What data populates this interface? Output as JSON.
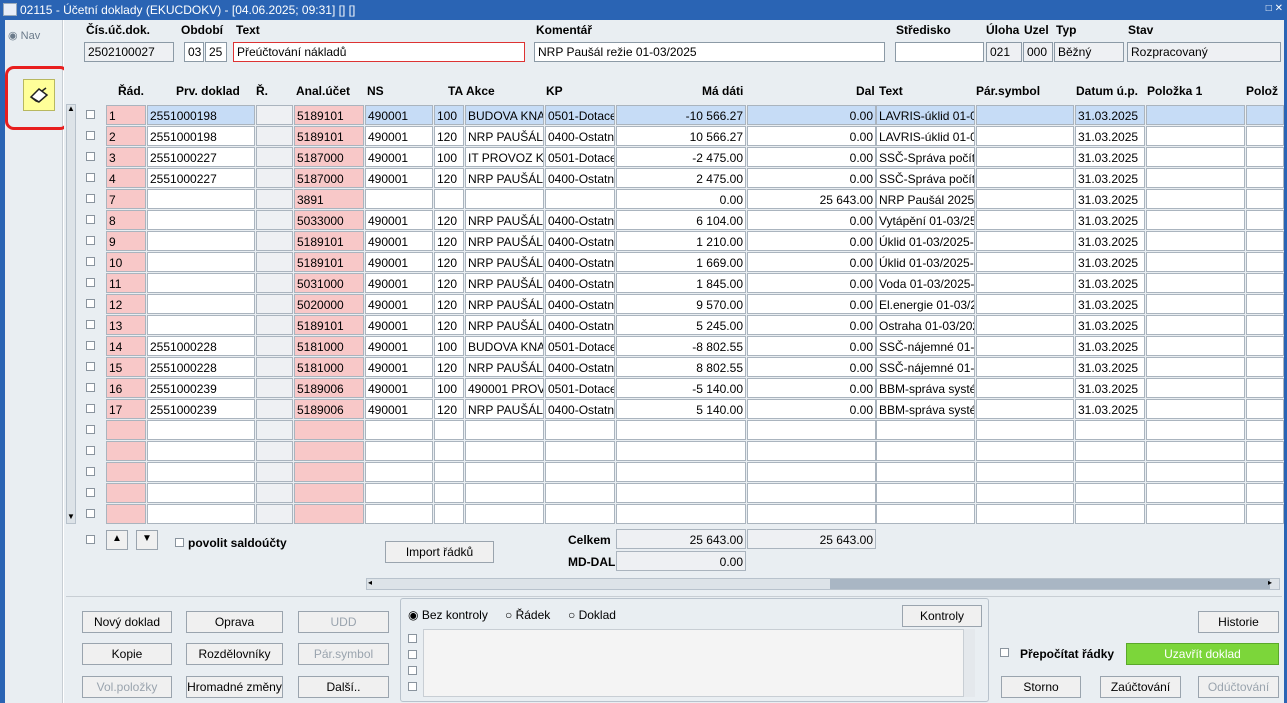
{
  "window": {
    "title": "02115 - Účetní doklady (EKUCDOKV) - [04.06.2025; 09:31] [] []",
    "controls": "□ ✕"
  },
  "nav": {
    "label": "Nav"
  },
  "header": {
    "labels": {
      "cis": "Čís.úč.dok.",
      "obdobi": "Období",
      "text": "Text",
      "komentar": "Komentář",
      "stredisko": "Středisko",
      "uloha": "Úloha",
      "uzel": "Uzel",
      "typ": "Typ",
      "stav": "Stav"
    },
    "values": {
      "cis": "2502100027",
      "obd1": "03",
      "obd2": "25",
      "text": "Přeúčtování nákladů",
      "komentar": "NRP Paušál režie 01-03/2025",
      "stredisko": "",
      "uloha": "021",
      "uzel": "000",
      "typ": "Běžný",
      "stav": "Rozpracovaný"
    }
  },
  "grid": {
    "columns": [
      "Řád.",
      "Prv. doklad",
      "Ř.",
      "Anal.účet",
      "NS",
      "TA",
      "Akce",
      "KP",
      "Má dáti",
      "Dal",
      "Text",
      "Pár.symbol",
      "Datum ú.p.",
      "Položka 1",
      "Polož"
    ],
    "rows": [
      [
        "1",
        "2551000198",
        "",
        "5189101",
        "490001",
        "100",
        "BUDOVA KNAV",
        "0501-Dotace",
        "-10 566.27",
        "0.00",
        "LAVRIS-úklid 01-0",
        "",
        "31.03.2025",
        "",
        ""
      ],
      [
        "2",
        "2551000198",
        "",
        "5189101",
        "490001",
        "120",
        "NRP PAUŠÁL",
        "0400-Ostatní",
        "10 566.27",
        "0.00",
        "LAVRIS-úklid 01-0",
        "",
        "31.03.2025",
        "",
        ""
      ],
      [
        "3",
        "2551000227",
        "",
        "5187000",
        "490001",
        "100",
        "IT PROVOZ KN",
        "0501-Dotace",
        "-2 475.00",
        "0.00",
        "SSČ-Správa počíta",
        "",
        "31.03.2025",
        "",
        ""
      ],
      [
        "4",
        "2551000227",
        "",
        "5187000",
        "490001",
        "120",
        "NRP PAUŠÁL",
        "0400-Ostatní",
        "2 475.00",
        "0.00",
        "SSČ-Správa počíta",
        "",
        "31.03.2025",
        "",
        ""
      ],
      [
        "7",
        "",
        "",
        "3891",
        "",
        "",
        "",
        "",
        "0.00",
        "25 643.00",
        "NRP Paušál 2025-",
        "",
        "31.03.2025",
        "",
        ""
      ],
      [
        "8",
        "",
        "",
        "5033000",
        "490001",
        "120",
        "NRP PAUŠÁL",
        "0400-Ostatní",
        "6 104.00",
        "0.00",
        "Vytápění 01-03/25",
        "",
        "31.03.2025",
        "",
        ""
      ],
      [
        "9",
        "",
        "",
        "5189101",
        "490001",
        "120",
        "NRP PAUŠÁL",
        "0400-Ostatní",
        "1 210.00",
        "0.00",
        "Úklid 01-03/2025-",
        "",
        "31.03.2025",
        "",
        ""
      ],
      [
        "10",
        "",
        "",
        "5189101",
        "490001",
        "120",
        "NRP PAUŠÁL",
        "0400-Ostatní",
        "1 669.00",
        "0.00",
        "Úklid 01-03/2025-",
        "",
        "31.03.2025",
        "",
        ""
      ],
      [
        "11",
        "",
        "",
        "5031000",
        "490001",
        "120",
        "NRP PAUŠÁL",
        "0400-Ostatní",
        "1 845.00",
        "0.00",
        "Voda 01-03/2025-",
        "",
        "31.03.2025",
        "",
        ""
      ],
      [
        "12",
        "",
        "",
        "5020000",
        "490001",
        "120",
        "NRP PAUŠÁL",
        "0400-Ostatní",
        "9 570.00",
        "0.00",
        "El.energie 01-03/2",
        "",
        "31.03.2025",
        "",
        ""
      ],
      [
        "13",
        "",
        "",
        "5189101",
        "490001",
        "120",
        "NRP PAUŠÁL",
        "0400-Ostatní",
        "5 245.00",
        "0.00",
        "Ostraha 01-03/202",
        "",
        "31.03.2025",
        "",
        ""
      ],
      [
        "14",
        "2551000228",
        "",
        "5181000",
        "490001",
        "100",
        "BUDOVA KNAV",
        "0501-Dotace",
        "-8 802.55",
        "0.00",
        "SSČ-nájemné 01-(",
        "",
        "31.03.2025",
        "",
        ""
      ],
      [
        "15",
        "2551000228",
        "",
        "5181000",
        "490001",
        "120",
        "NRP PAUŠÁL",
        "0400-Ostatní",
        "8 802.55",
        "0.00",
        "SSČ-nájemné 01-(",
        "",
        "31.03.2025",
        "",
        ""
      ],
      [
        "16",
        "2551000239",
        "",
        "5189006",
        "490001",
        "100",
        "490001 PROV",
        "0501-Dotace",
        "-5 140.00",
        "0.00",
        "BBM-správa systé",
        "",
        "31.03.2025",
        "",
        ""
      ],
      [
        "17",
        "2551000239",
        "",
        "5189006",
        "490001",
        "120",
        "NRP PAUŠÁL",
        "0400-Ostatní",
        "5 140.00",
        "0.00",
        "BBM-správa systé",
        "",
        "31.03.2025",
        "",
        ""
      ]
    ]
  },
  "footer": {
    "povolit": "povolit saldoúčty",
    "import": "Import řádků",
    "celkem_label": "Celkem",
    "celkem_md": "25 643.00",
    "celkem_dal": "25 643.00",
    "mddal_label": "MD-DAL",
    "mddal_value": "0.00"
  },
  "buttons": {
    "novy": "Nový doklad",
    "oprava": "Oprava",
    "udd": "UDD",
    "kopie": "Kopie",
    "rozdel": "Rozdělovníky",
    "parsym": "Pár.symbol",
    "volpol": "Vol.položky",
    "hromadne": "Hromadné změny",
    "dalsi": "Další..",
    "kontroly": "Kontroly",
    "historie": "Historie",
    "storno": "Storno",
    "zauct": "Zaúčtování",
    "oduct": "Odúčtování",
    "uzavrit": "Uzavřít doklad"
  },
  "checks": {
    "bez": "Bez kontroly",
    "radek": "Řádek",
    "doklad": "Doklad",
    "prepocitat": "Přepočítat řádky"
  }
}
